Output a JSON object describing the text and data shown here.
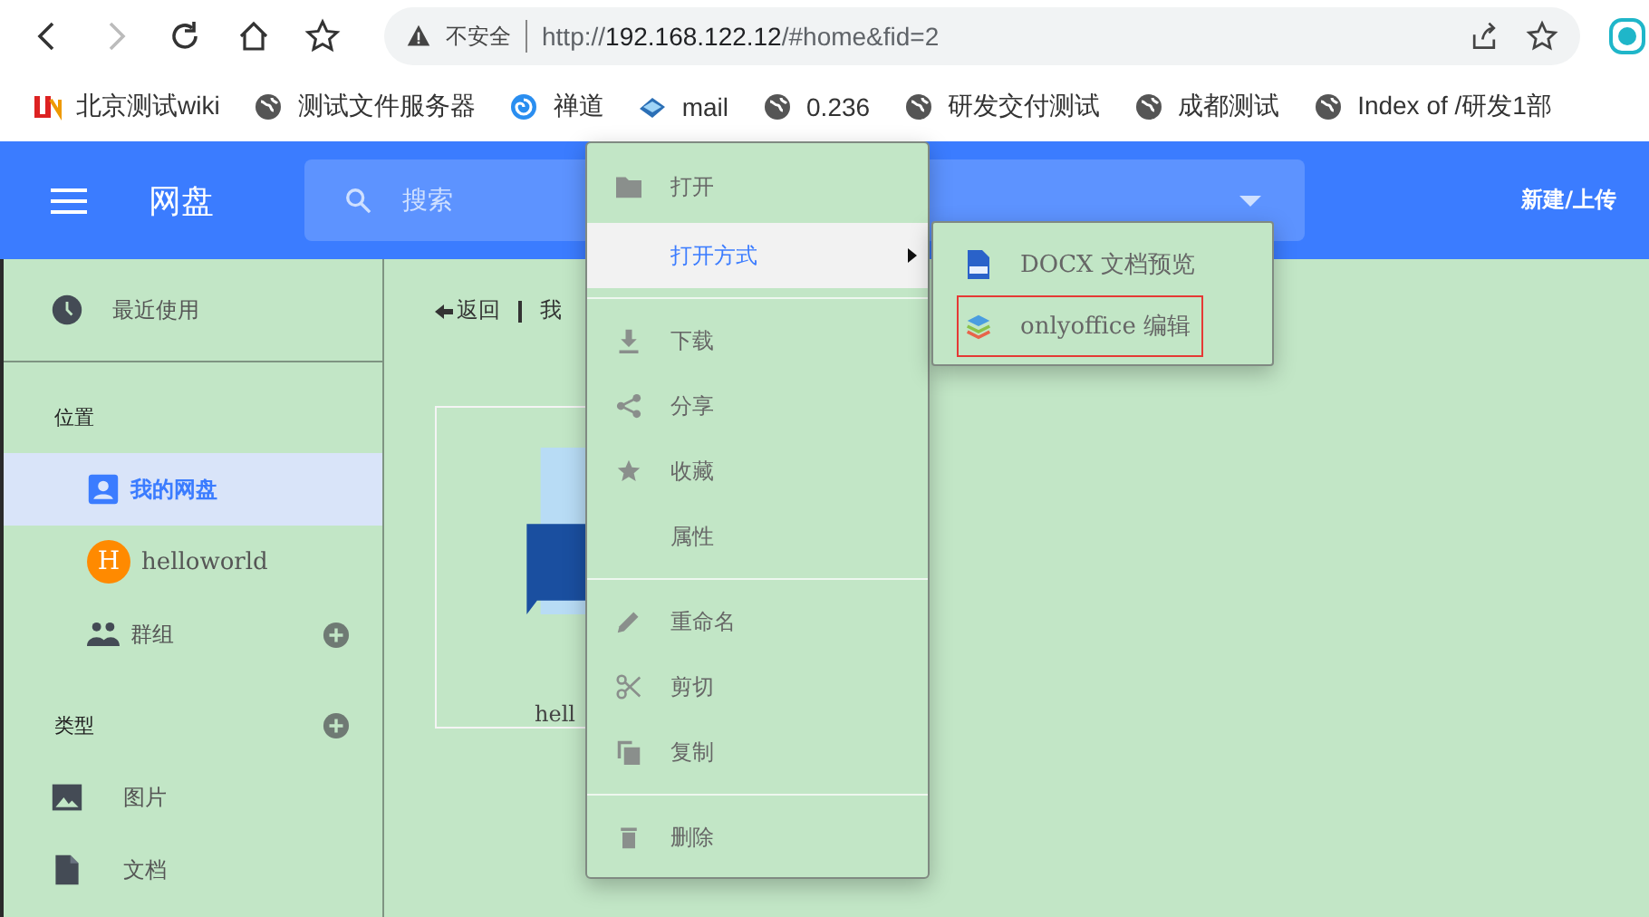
{
  "browser": {
    "security": "不安全",
    "url": {
      "scheme": "http://",
      "host": "192.168.122.12",
      "path": "/#home&fid=2"
    },
    "forward_disabled": true
  },
  "bookmarks": [
    {
      "label": "北京测试wiki",
      "kind": "brand"
    },
    {
      "label": "测试文件服务器",
      "kind": "globe"
    },
    {
      "label": "禅道",
      "kind": "swirl"
    },
    {
      "label": "mail",
      "kind": "mail"
    },
    {
      "label": "0.236",
      "kind": "globe"
    },
    {
      "label": "研发交付测试",
      "kind": "globe"
    },
    {
      "label": "成都测试",
      "kind": "globe"
    },
    {
      "label": "Index of /研发1部",
      "kind": "globe"
    }
  ],
  "header": {
    "title": "网盘",
    "search_placeholder": "搜索",
    "new_upload": "新建/上传"
  },
  "sidebar": {
    "recent": "最近使用",
    "sections": [
      {
        "label": "位置",
        "has_add": false,
        "items": [
          {
            "label": "我的网盘",
            "kind": "account",
            "selected": true,
            "has_add": false
          },
          {
            "label": "helloworld",
            "kind": "avatar",
            "avatar": "H",
            "selected": false,
            "has_add": false
          },
          {
            "label": "群组",
            "kind": "group",
            "selected": false,
            "has_add": true
          }
        ]
      },
      {
        "label": "类型",
        "has_add": true,
        "items": [
          {
            "label": "图片",
            "kind": "image",
            "selected": false,
            "has_add": false
          },
          {
            "label": "文档",
            "kind": "file",
            "selected": false,
            "has_add": false
          }
        ]
      }
    ]
  },
  "breadcrumb": {
    "back": "返回",
    "path": "我"
  },
  "file": {
    "name": "hell"
  },
  "context_menu": [
    {
      "kind": "item",
      "label": "打开",
      "selected": false
    },
    {
      "kind": "submenu",
      "label": "打开方式",
      "selected": true
    },
    {
      "kind": "divider"
    },
    {
      "kind": "item",
      "label": "下载",
      "selected": false
    },
    {
      "kind": "item",
      "label": "分享",
      "selected": false
    },
    {
      "kind": "item",
      "label": "收藏",
      "selected": false
    },
    {
      "kind": "item",
      "label": "属性",
      "selected": false
    },
    {
      "kind": "divider"
    },
    {
      "kind": "item",
      "label": "重命名",
      "selected": false
    },
    {
      "kind": "item",
      "label": "剪切",
      "selected": false
    },
    {
      "kind": "item",
      "label": "复制",
      "selected": false
    },
    {
      "kind": "divider"
    },
    {
      "kind": "item",
      "label": "删除",
      "selected": false
    }
  ],
  "submenu": [
    {
      "label": "DOCX 文档预览",
      "kind": "docx",
      "outlined": false
    },
    {
      "label": "onlyoffice 编辑",
      "kind": "layers",
      "outlined": true
    }
  ]
}
